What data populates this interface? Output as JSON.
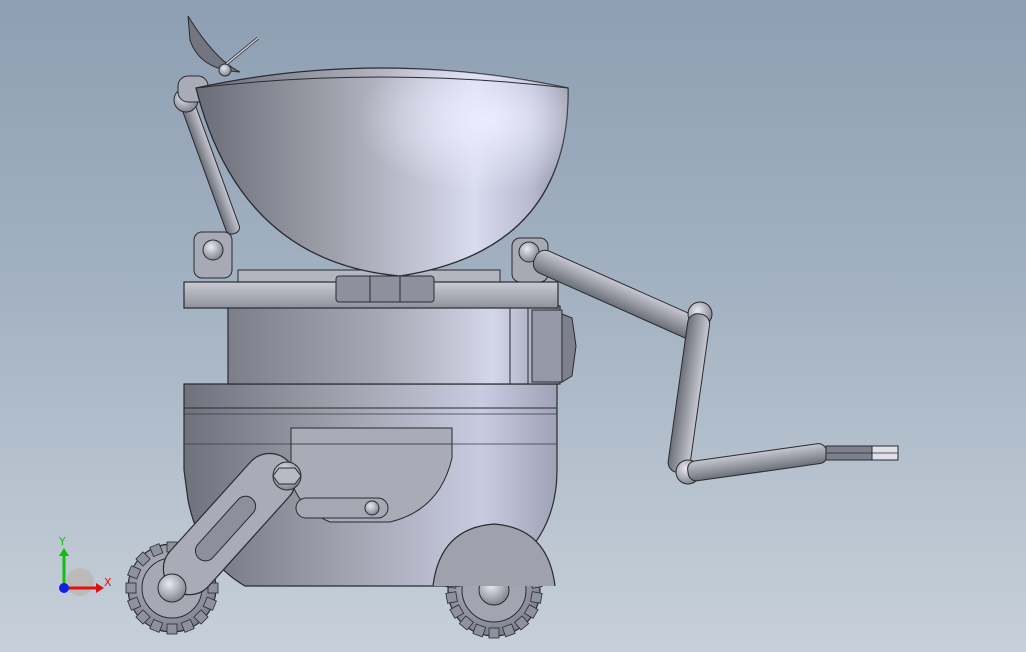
{
  "model": {
    "parts": [
      "satellite-dish",
      "bowl-head",
      "left-arm",
      "right-arm",
      "neck-plate",
      "torso-cylinder",
      "side-motor",
      "lower-body",
      "side-hatch",
      "track-crank",
      "rear-wheel"
    ]
  },
  "triad": {
    "x_label": "X",
    "y_label": "Y",
    "x_color": "#e01010",
    "y_color": "#10c010",
    "z_color": "#1020e0"
  },
  "colors": {
    "metal_dark": "#5f6470",
    "metal_mid": "#9a9ca8",
    "metal_light": "#e2e4f4",
    "edge": "#2a2a30"
  }
}
